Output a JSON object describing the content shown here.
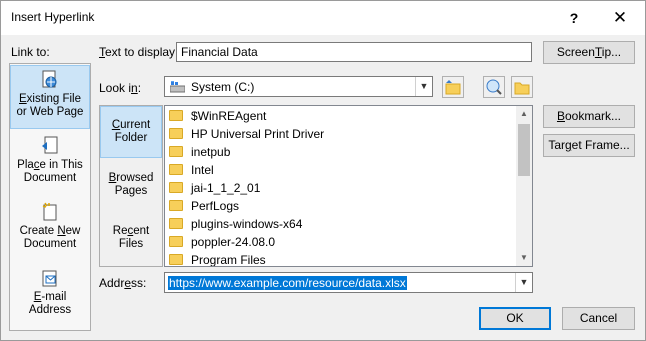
{
  "window": {
    "title": "Insert Hyperlink",
    "help": "?",
    "close": "✕"
  },
  "labels": {
    "link_to": "Link to:",
    "text_to_display": "Text to display:",
    "look_in": "Look in:",
    "address": "Address:"
  },
  "text_to_display_value": "Financial Data",
  "look_in_value": "System (C:)",
  "address_value": "https://www.example.com/resource/data.xlsx",
  "link_to_items": [
    {
      "line1": "Existing File",
      "line2": "or Web Page",
      "icon": "existing-file-icon",
      "selected": true
    },
    {
      "line1": "Place in This",
      "line2": "Document",
      "icon": "place-in-document-icon",
      "selected": false
    },
    {
      "line1": "Create New",
      "line2": "Document",
      "icon": "create-new-document-icon",
      "selected": false
    },
    {
      "line1": "E-mail",
      "line2": "Address",
      "icon": "email-address-icon",
      "selected": false
    }
  ],
  "nav_items": [
    {
      "line1": "Current",
      "line2": "Folder",
      "selected": true
    },
    {
      "line1": "Browsed",
      "line2": "Pages",
      "selected": false
    },
    {
      "line1": "Recent",
      "line2": "Files",
      "selected": false
    }
  ],
  "files": [
    "$WinREAgent",
    "HP Universal Print Driver",
    "inetpub",
    "Intel",
    "jai-1_1_2_01",
    "PerfLogs",
    "plugins-windows-x64",
    "poppler-24.08.0",
    "Program Files"
  ],
  "buttons": {
    "screentip": "ScreenTip...",
    "bookmark": "Bookmark...",
    "target_frame": "Target Frame...",
    "ok": "OK",
    "cancel": "Cancel"
  },
  "colors": {
    "selection": "#cce4f7",
    "accent": "#0078d7",
    "folder": "#f7cf5a"
  }
}
